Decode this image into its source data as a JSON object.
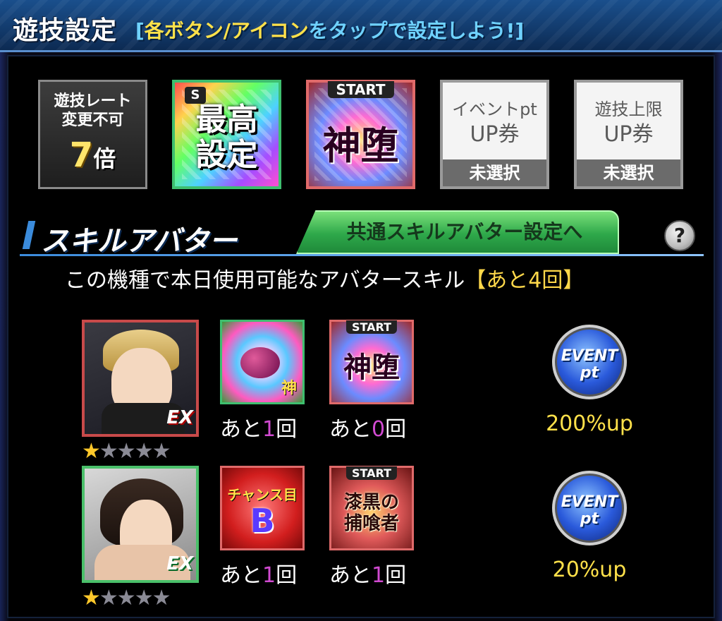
{
  "header": {
    "title": "遊技設定",
    "subtitle_prefix": "[",
    "subtitle_highlight": "各ボタン/アイコン",
    "subtitle_rest": "をタップで設定しよう!]"
  },
  "settings": {
    "rate": {
      "line1": "遊技レート",
      "line2": "変更不可",
      "multiplier": "7",
      "unit": "倍"
    },
    "setting_tile": {
      "badge": "S",
      "text": "最高設定"
    },
    "start_tile": {
      "tag": "START",
      "text": "神堕"
    },
    "event_ticket": {
      "line1": "イベントpt",
      "line2": "UP券",
      "status": "未選択"
    },
    "limit_ticket": {
      "line1": "遊技上限",
      "line2": "UP券",
      "status": "未選択"
    }
  },
  "skill_section": {
    "title": "スキルアバター",
    "common_button": "共通スキルアバター設定へ",
    "help": "?",
    "usable_text": "この機種で本日使用可能なアバタースキル",
    "remaining": "【あと4回】"
  },
  "avatars": [
    {
      "ex": "EX",
      "stars": {
        "filled": 1,
        "total": 5
      },
      "skill1": {
        "label": "神",
        "remain_prefix": "あと",
        "remain_count": "1",
        "remain_suffix": "回"
      },
      "skill2": {
        "tag": "START",
        "label": "神堕",
        "remain_prefix": "あと",
        "remain_count": "0",
        "remain_suffix": "回"
      },
      "event": {
        "line1": "EVENT",
        "line2": "pt",
        "value": "200%up"
      }
    },
    {
      "ex": "EX",
      "stars": {
        "filled": 1,
        "total": 5
      },
      "skill1": {
        "label1": "チャンス目",
        "label2": "B",
        "remain_prefix": "あと",
        "remain_count": "1",
        "remain_suffix": "回"
      },
      "skill2": {
        "tag": "START",
        "label": "漆黒の捕喰者",
        "remain_prefix": "あと",
        "remain_count": "1",
        "remain_suffix": "回"
      },
      "event": {
        "line1": "EVENT",
        "line2": "pt",
        "value": "20%up"
      }
    }
  ],
  "colors": {
    "header_blue": "#1a4f8c",
    "accent_green": "#2ea84a",
    "gold": "#ffe14a",
    "count_purple": "#d14ad1"
  }
}
